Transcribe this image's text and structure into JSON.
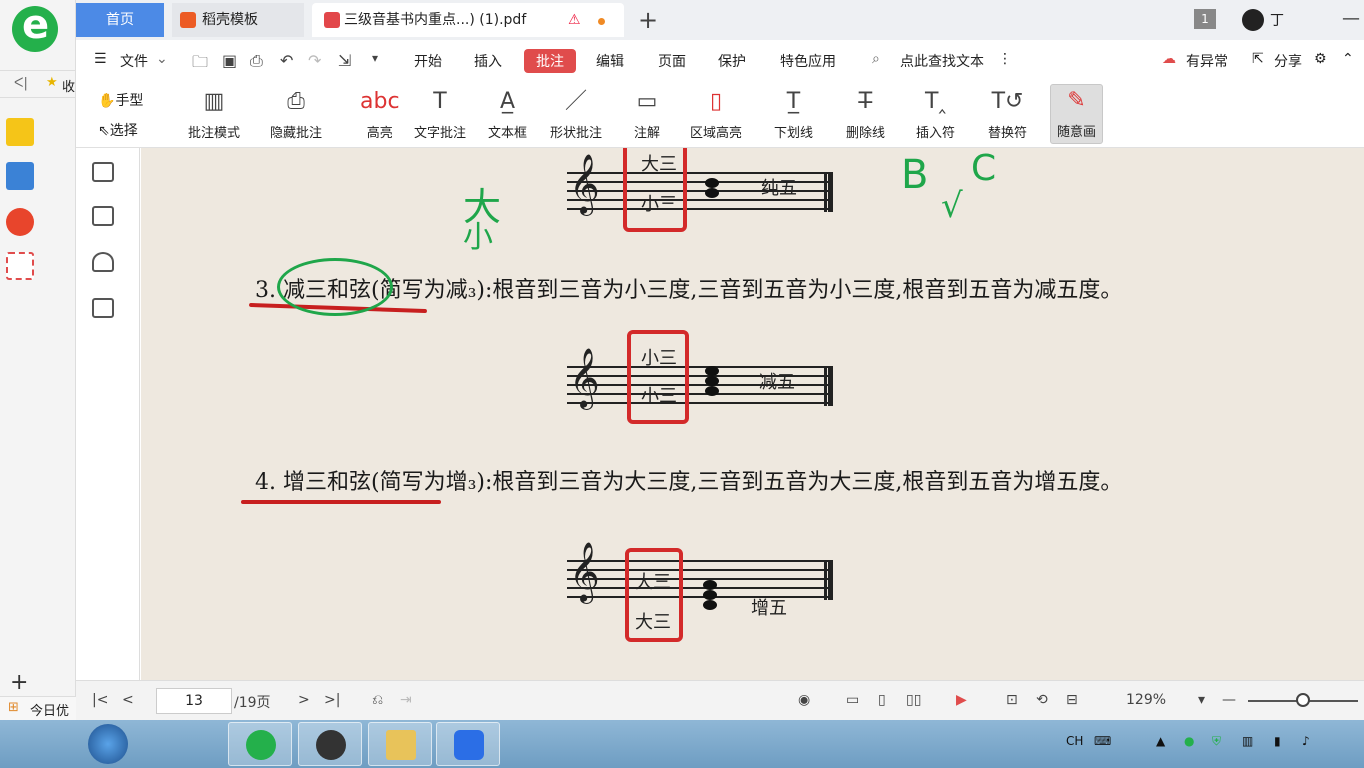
{
  "browser": {
    "fav_label": "收",
    "today_label": "今日优"
  },
  "tabs": [
    {
      "label": "首页"
    },
    {
      "label": "稻壳模板"
    },
    {
      "label": "三级音基书内重点...) (1).pdf"
    }
  ],
  "window": {
    "page_badge": "1",
    "user": "丁"
  },
  "menu": {
    "file": "文件",
    "items": [
      "开始",
      "插入",
      "批注",
      "编辑",
      "页面",
      "保护",
      "特色应用"
    ],
    "search": "点此查找文本",
    "exception": "有异常",
    "share": "分享"
  },
  "ribbon": {
    "hand": "手型",
    "select": "选择",
    "items": [
      "批注模式",
      "隐藏批注",
      "高亮",
      "文字批注",
      "文本框",
      "形状批注",
      "注解",
      "区域高亮",
      "下划线",
      "删除线",
      "插入符",
      "替换符",
      "随意画"
    ]
  },
  "document": {
    "line3": "3. 减三和弦(简写为减₃):根音到三音为小三度,三音到五音为小三度,根音到五音为减五度。",
    "line4": "4. 增三和弦(简写为增₃):根音到三音为大三度,三音到五音为大三度,根音到五音为增五度。",
    "ex1": {
      "top": "大三",
      "bottom": "小三",
      "right": "纯五"
    },
    "ex2": {
      "top": "小三",
      "bottom": "小三",
      "right": "减五"
    },
    "ex3": {
      "top": "大三",
      "bottom": "大三",
      "right": "增五"
    },
    "handwriting": [
      "大",
      "小",
      "B",
      "C",
      "√"
    ]
  },
  "status": {
    "page": "13",
    "total": "/19页",
    "zoom": "129%"
  },
  "taskbar": {
    "ime": "CH"
  },
  "colors": {
    "accent": "#4c8ae6",
    "annot_red": "#e04c4c",
    "ink_red": "#d32a2a",
    "ink_green": "#1fa64a"
  }
}
